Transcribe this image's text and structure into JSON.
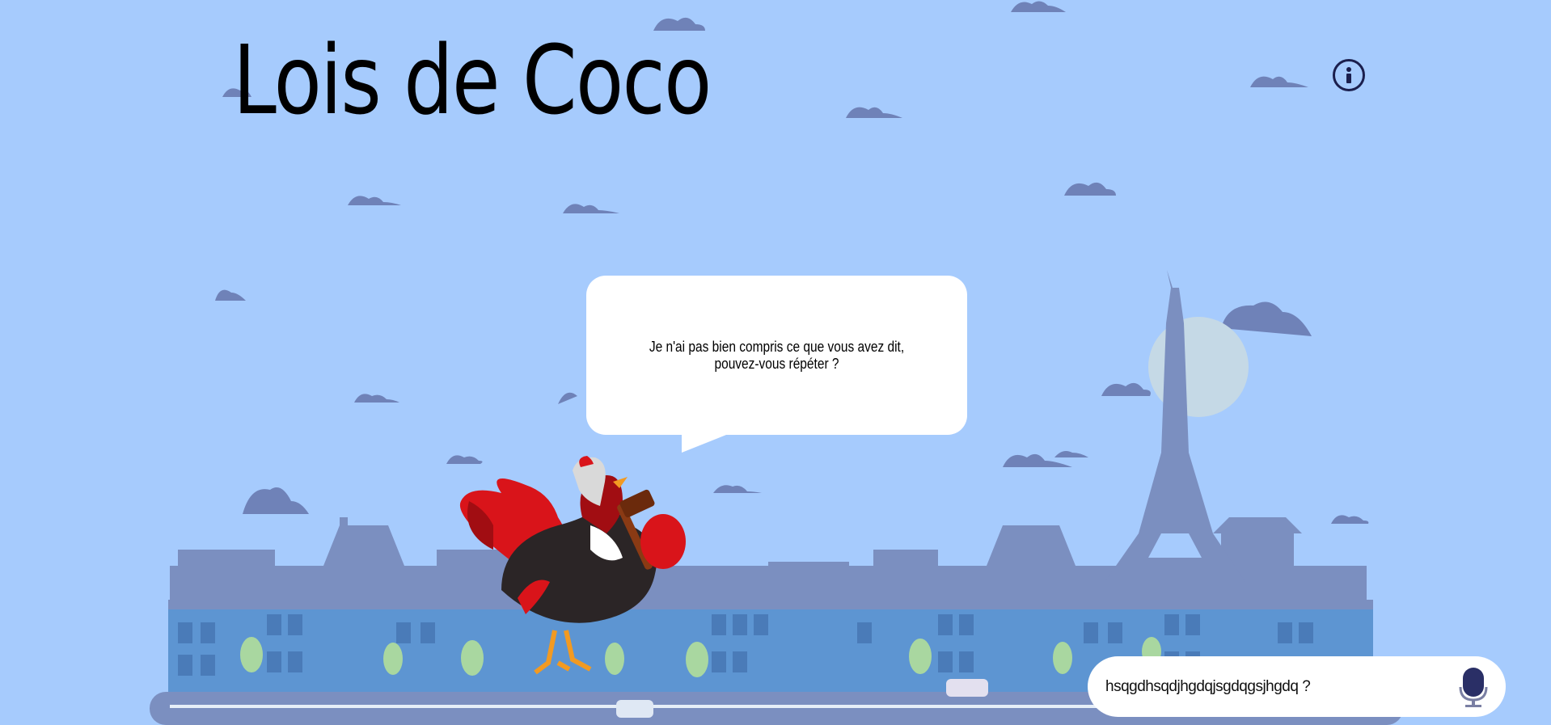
{
  "app": {
    "title": "Lois de Coco"
  },
  "header": {
    "info_icon": "info-circle-icon"
  },
  "chat": {
    "bot_message": "Je n'ai pas bien compris ce que vous avez dit, pouvez-vous répéter ?"
  },
  "input": {
    "value": "hsqgdhsqdjhgdqjsgdqgsjhgdq ?",
    "mic_icon": "microphone-icon"
  },
  "colors": {
    "sky": "#a6cbfd",
    "city": "#7b8fc0",
    "buildings_front": "#5d95d2",
    "mic": "#2a2f66"
  }
}
